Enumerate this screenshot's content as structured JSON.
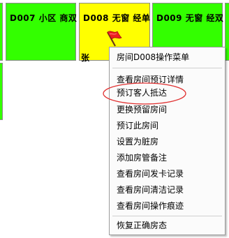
{
  "rooms": [
    {
      "title": "D007  小区 商双",
      "color": "#33ff00"
    },
    {
      "title": "D008  无窗 经单",
      "color": "#ffff00",
      "guest": "张",
      "flag_icon": "red-flag-icon"
    },
    {
      "title": "D009  无窗 经双",
      "color": "#33ff00"
    }
  ],
  "context_menu": {
    "header": "房间D008操作菜单",
    "items": [
      "查看房间预订详情",
      "预订客人抵达",
      "更换预留房间",
      "预订此房间",
      "设置为脏房",
      "添加房管备注",
      "查看房间发卡记录",
      "查看房间清洁记录",
      "查看房间操作痕迹"
    ],
    "footer": "恢复正确房态"
  },
  "colors": {
    "available": "#33ff00",
    "reserved": "#ffff00",
    "annotation": "#e03030"
  }
}
